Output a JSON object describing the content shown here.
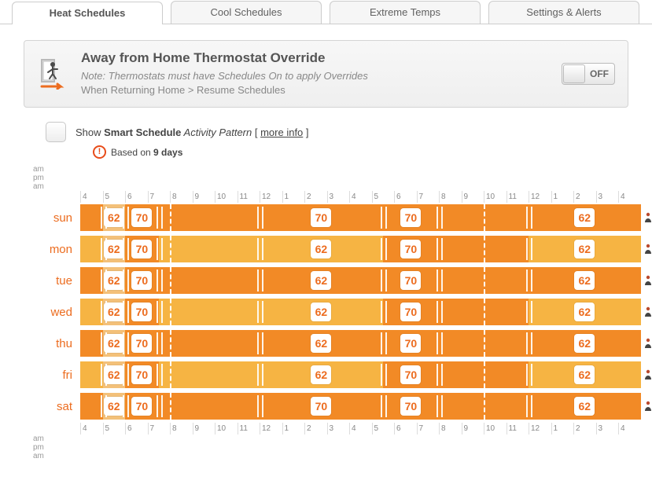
{
  "tabs": {
    "heat": "Heat Schedules",
    "cool": "Cool Schedules",
    "extreme": "Extreme Temps",
    "settings": "Settings & Alerts",
    "active_index": 0
  },
  "panel": {
    "title": "Away from Home Thermostat Override",
    "note1": "Note: Thermostats must have Schedules On to apply Overrides",
    "note2": "When Returning Home > Resume Schedules",
    "toggle_label": "OFF"
  },
  "smart": {
    "show_prefix": "Show ",
    "bold": "Smart Schedule",
    "italic": " Activity Pattern",
    "more_info": "more info",
    "based_prefix": "Based on ",
    "based_days": "9 days"
  },
  "time_axis": {
    "ampm_first": "am",
    "ampm_mid": "pm",
    "ampm_last": "am",
    "hours": [
      "4",
      "5",
      "6",
      "7",
      "8",
      "9",
      "10",
      "11",
      "12",
      "1",
      "2",
      "3",
      "4",
      "5",
      "6",
      "7",
      "8",
      "9",
      "10",
      "11",
      "12",
      "1",
      "2",
      "3",
      "4"
    ]
  },
  "days": [
    {
      "label": "sun",
      "segments": [
        {
          "start": 0,
          "end": 1,
          "color": "orange",
          "value": null
        },
        {
          "start": 1,
          "end": 2,
          "color": "pale",
          "value": "62"
        },
        {
          "start": 2,
          "end": 3.5,
          "color": "orange",
          "value": "70"
        },
        {
          "start": 3.5,
          "end": 8,
          "color": "orange",
          "value": null
        },
        {
          "start": 8,
          "end": 13.5,
          "color": "orange",
          "value": "70"
        },
        {
          "start": 13.5,
          "end": 16,
          "color": "orange",
          "value": "70"
        },
        {
          "start": 16,
          "end": 20,
          "color": "orange",
          "value": null
        },
        {
          "start": 20,
          "end": 25,
          "color": "orange",
          "value": "62"
        }
      ],
      "handles": [
        1,
        2,
        3.5,
        8,
        13.5,
        16,
        20
      ],
      "dividers": [
        4,
        18
      ]
    },
    {
      "label": "mon",
      "segments": [
        {
          "start": 0,
          "end": 1,
          "color": "yellow",
          "value": null
        },
        {
          "start": 1,
          "end": 2,
          "color": "pale",
          "value": "62"
        },
        {
          "start": 2,
          "end": 3.5,
          "color": "orange",
          "value": "70"
        },
        {
          "start": 3.5,
          "end": 8,
          "color": "yellow",
          "value": null
        },
        {
          "start": 8,
          "end": 13.5,
          "color": "yellow",
          "value": "62"
        },
        {
          "start": 13.5,
          "end": 16,
          "color": "orange",
          "value": "70"
        },
        {
          "start": 16,
          "end": 20,
          "color": "orange",
          "value": null
        },
        {
          "start": 20,
          "end": 25,
          "color": "yellow",
          "value": "62"
        }
      ],
      "handles": [
        1,
        2,
        3.5,
        8,
        13.5,
        16,
        20
      ],
      "dividers": [
        4,
        18
      ]
    },
    {
      "label": "tue",
      "segments": [
        {
          "start": 0,
          "end": 1,
          "color": "orange",
          "value": null
        },
        {
          "start": 1,
          "end": 2,
          "color": "pale",
          "value": "62"
        },
        {
          "start": 2,
          "end": 3.5,
          "color": "orange",
          "value": "70"
        },
        {
          "start": 3.5,
          "end": 8,
          "color": "orange",
          "value": null
        },
        {
          "start": 8,
          "end": 13.5,
          "color": "orange",
          "value": "62"
        },
        {
          "start": 13.5,
          "end": 16,
          "color": "orange",
          "value": "70"
        },
        {
          "start": 16,
          "end": 20,
          "color": "orange",
          "value": null
        },
        {
          "start": 20,
          "end": 25,
          "color": "orange",
          "value": "62"
        }
      ],
      "handles": [
        1,
        2,
        3.5,
        8,
        13.5,
        16,
        20
      ],
      "dividers": [
        4,
        18
      ]
    },
    {
      "label": "wed",
      "segments": [
        {
          "start": 0,
          "end": 1,
          "color": "yellow",
          "value": null
        },
        {
          "start": 1,
          "end": 2,
          "color": "pale",
          "value": "62"
        },
        {
          "start": 2,
          "end": 3.5,
          "color": "orange",
          "value": "70"
        },
        {
          "start": 3.5,
          "end": 8,
          "color": "yellow",
          "value": null
        },
        {
          "start": 8,
          "end": 13.5,
          "color": "yellow",
          "value": "62"
        },
        {
          "start": 13.5,
          "end": 16,
          "color": "orange",
          "value": "70"
        },
        {
          "start": 16,
          "end": 20,
          "color": "orange",
          "value": null
        },
        {
          "start": 20,
          "end": 25,
          "color": "yellow",
          "value": "62"
        }
      ],
      "handles": [
        1,
        2,
        3.5,
        8,
        13.5,
        16,
        20
      ],
      "dividers": [
        4,
        18
      ]
    },
    {
      "label": "thu",
      "segments": [
        {
          "start": 0,
          "end": 1,
          "color": "orange",
          "value": null
        },
        {
          "start": 1,
          "end": 2,
          "color": "pale",
          "value": "62"
        },
        {
          "start": 2,
          "end": 3.5,
          "color": "orange",
          "value": "70"
        },
        {
          "start": 3.5,
          "end": 8,
          "color": "orange",
          "value": null
        },
        {
          "start": 8,
          "end": 13.5,
          "color": "orange",
          "value": "62"
        },
        {
          "start": 13.5,
          "end": 16,
          "color": "orange",
          "value": "70"
        },
        {
          "start": 16,
          "end": 20,
          "color": "orange",
          "value": null
        },
        {
          "start": 20,
          "end": 25,
          "color": "orange",
          "value": "62"
        }
      ],
      "handles": [
        1,
        2,
        3.5,
        8,
        13.5,
        16,
        20
      ],
      "dividers": [
        4,
        18
      ]
    },
    {
      "label": "fri",
      "segments": [
        {
          "start": 0,
          "end": 1,
          "color": "yellow",
          "value": null
        },
        {
          "start": 1,
          "end": 2,
          "color": "pale",
          "value": "62"
        },
        {
          "start": 2,
          "end": 3.5,
          "color": "orange",
          "value": "70"
        },
        {
          "start": 3.5,
          "end": 8,
          "color": "yellow",
          "value": null
        },
        {
          "start": 8,
          "end": 13.5,
          "color": "yellow",
          "value": "62"
        },
        {
          "start": 13.5,
          "end": 16,
          "color": "orange",
          "value": "70"
        },
        {
          "start": 16,
          "end": 20,
          "color": "orange",
          "value": null
        },
        {
          "start": 20,
          "end": 25,
          "color": "yellow",
          "value": "62"
        }
      ],
      "handles": [
        1,
        2,
        3.5,
        8,
        13.5,
        16,
        20
      ],
      "dividers": [
        4,
        18
      ]
    },
    {
      "label": "sat",
      "segments": [
        {
          "start": 0,
          "end": 1,
          "color": "orange",
          "value": null
        },
        {
          "start": 1,
          "end": 2,
          "color": "pale",
          "value": "62"
        },
        {
          "start": 2,
          "end": 3.5,
          "color": "orange",
          "value": "70"
        },
        {
          "start": 3.5,
          "end": 8,
          "color": "orange",
          "value": null
        },
        {
          "start": 8,
          "end": 13.5,
          "color": "orange",
          "value": "70"
        },
        {
          "start": 13.5,
          "end": 16,
          "color": "orange",
          "value": "70"
        },
        {
          "start": 16,
          "end": 20,
          "color": "orange",
          "value": null
        },
        {
          "start": 20,
          "end": 25,
          "color": "orange",
          "value": "62"
        }
      ],
      "handles": [
        1,
        2,
        3.5,
        8,
        13.5,
        16,
        20
      ],
      "dividers": [
        4,
        18
      ]
    }
  ]
}
